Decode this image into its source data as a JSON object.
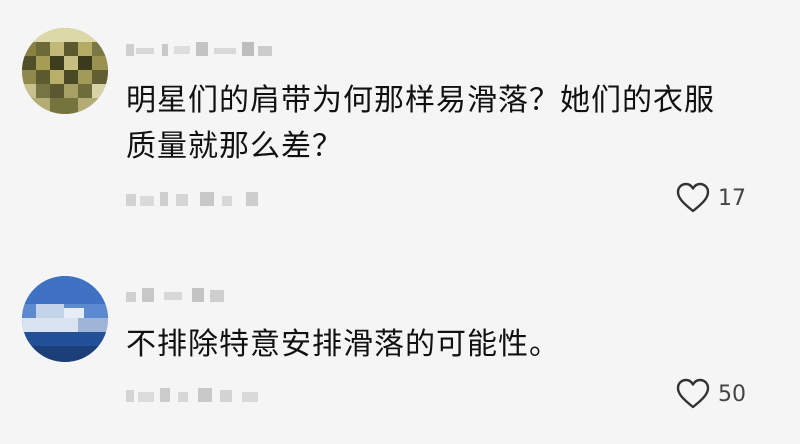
{
  "comments": [
    {
      "username": "",
      "text": "明星们的肩带为何那样易滑落？她们的衣服质量就那么差？",
      "timestamp": "",
      "likes": "17",
      "avatar_icon": "pixelated-avatar-icon",
      "like_icon": "heart-icon"
    },
    {
      "username": "",
      "text": "不排除特意安排滑落的可能性。",
      "timestamp": "",
      "likes": "50",
      "avatar_icon": "pixelated-avatar-icon",
      "like_icon": "heart-icon"
    }
  ],
  "colors": {
    "background": "#f5f5f5",
    "text": "#111111",
    "muted": "#444444"
  }
}
